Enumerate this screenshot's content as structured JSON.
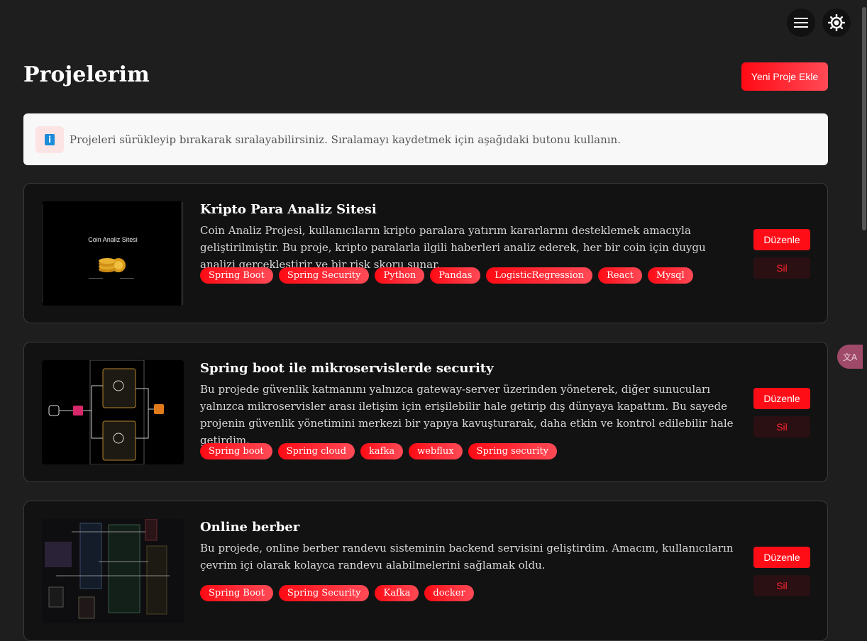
{
  "header": {
    "title": "Projelerim",
    "add_button": "Yeni Proje Ekle",
    "menu_icon": "hamburger-menu-icon",
    "theme_icon": "brightness-icon"
  },
  "info": {
    "text": "Projeleri sürükleyip bırakarak sıralayabilirsiniz. Sıralamayı kaydetmek için aşağıdaki butonu kullanın.",
    "icon": "info-icon"
  },
  "projects": [
    {
      "title": "Kripto Para Analiz Sitesi",
      "description": "Coin Analiz Projesi, kullanıcıların kripto paralara yatırım kararlarını desteklemek amacıyla geliştirilmiştir. Bu proje, kripto paralarla ilgili haberleri analiz ederek, her bir coin için duygu analizi gerçekleştirir ve bir risk skoru sunar.",
      "image_title": "Coin Analiz Sitesi",
      "tags": [
        "Spring Boot",
        "Spring Security",
        "Python",
        "Pandas",
        "LogisticRegression",
        "React",
        "Mysql"
      ],
      "edit": "Düzenle",
      "delete": "Sil"
    },
    {
      "title": "Spring boot ile mikroservislerde security",
      "description": "Bu projede güvenlik katmanını yalnızca gateway-server üzerinden yöneterek, diğer sunucuları yalnızca mikroservisler arası iletişim için erişilebilir hale getirip dış dünyaya kapattım. Bu sayede projenin güvenlik yönetimini merkezi bir yapıya kavuşturarak, daha etkin ve kontrol edilebilir hale getirdim.",
      "tags": [
        "Spring boot",
        "Spring cloud",
        "kafka",
        "webflux",
        "Spring security"
      ],
      "edit": "Düzenle",
      "delete": "Sil"
    },
    {
      "title": "Online berber",
      "description": "Bu projede, online berber randevu sisteminin backend servisini geliştirdim. Amacım, kullanıcıların çevrim içi olarak kolayca randevu alabilmelerini sağlamak oldu.",
      "tags": [
        "Spring Boot",
        "Spring Security",
        "Kafka",
        "docker"
      ],
      "edit": "Düzenle",
      "delete": "Sil"
    }
  ],
  "colors": {
    "accent": "#ff0a14",
    "background": "#1e1e1f",
    "card": "#121213"
  }
}
